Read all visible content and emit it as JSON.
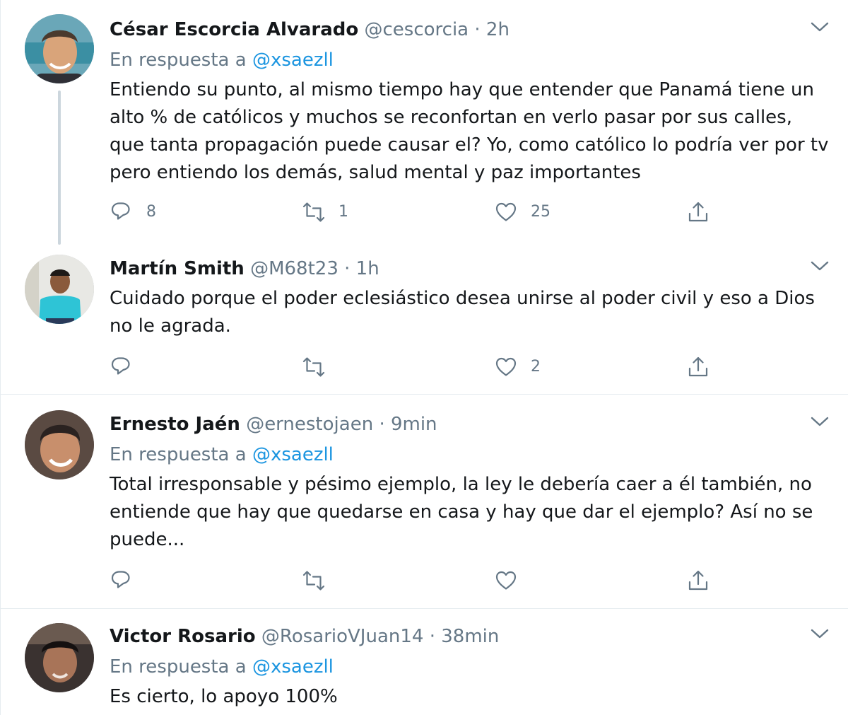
{
  "tweets": [
    {
      "name": "César Escorcia Alvarado",
      "handle": "@cescorcia",
      "separator": "·",
      "time": "2h",
      "reply_prefix": "En respuesta a ",
      "reply_mention": "@xsaezll",
      "text": "Entiendo su punto, al mismo tiempo hay que entender que Panamá tiene un alto % de católicos y muchos se reconfortan en verlo pasar por sus calles, que tanta propagación puede causar el? Yo, como católico lo podría ver por tv pero entiendo los demás, salud mental y paz importantes",
      "replies": "8",
      "retweets": "1",
      "likes": "25"
    },
    {
      "name": "Martín Smith",
      "handle": "@M68t23",
      "separator": "·",
      "time": "1h",
      "text": "Cuidado porque el poder eclesiástico desea unirse al poder civil y eso a Dios no le agrada.",
      "replies": "",
      "retweets": "",
      "likes": "2"
    },
    {
      "name": "Ernesto Jaén",
      "handle": "@ernestojaen",
      "separator": "·",
      "time": "9min",
      "reply_prefix": "En respuesta a ",
      "reply_mention": "@xsaezll",
      "text": "Total irresponsable y pésimo ejemplo, la ley le debería caer a él también, no entiende que hay que quedarse en casa y hay que dar el ejemplo? Así no se puede...",
      "replies": "",
      "retweets": "",
      "likes": ""
    },
    {
      "name": "Victor Rosario",
      "handle": "@RosarioVJuan14",
      "separator": "·",
      "time": "38min",
      "reply_prefix": "En respuesta a ",
      "reply_mention": "@xsaezll",
      "text": "Es cierto, lo apoyo 100%"
    }
  ],
  "colors": {
    "text": "#14171a",
    "secondary": "#657786",
    "link": "#1b95e0",
    "divider": "#e6ecf0",
    "thread_line": "#ccd6dd"
  },
  "icons": {
    "reply": "reply-icon",
    "retweet": "retweet-icon",
    "like": "heart-icon",
    "share": "share-icon",
    "menu": "chevron-down-icon"
  }
}
